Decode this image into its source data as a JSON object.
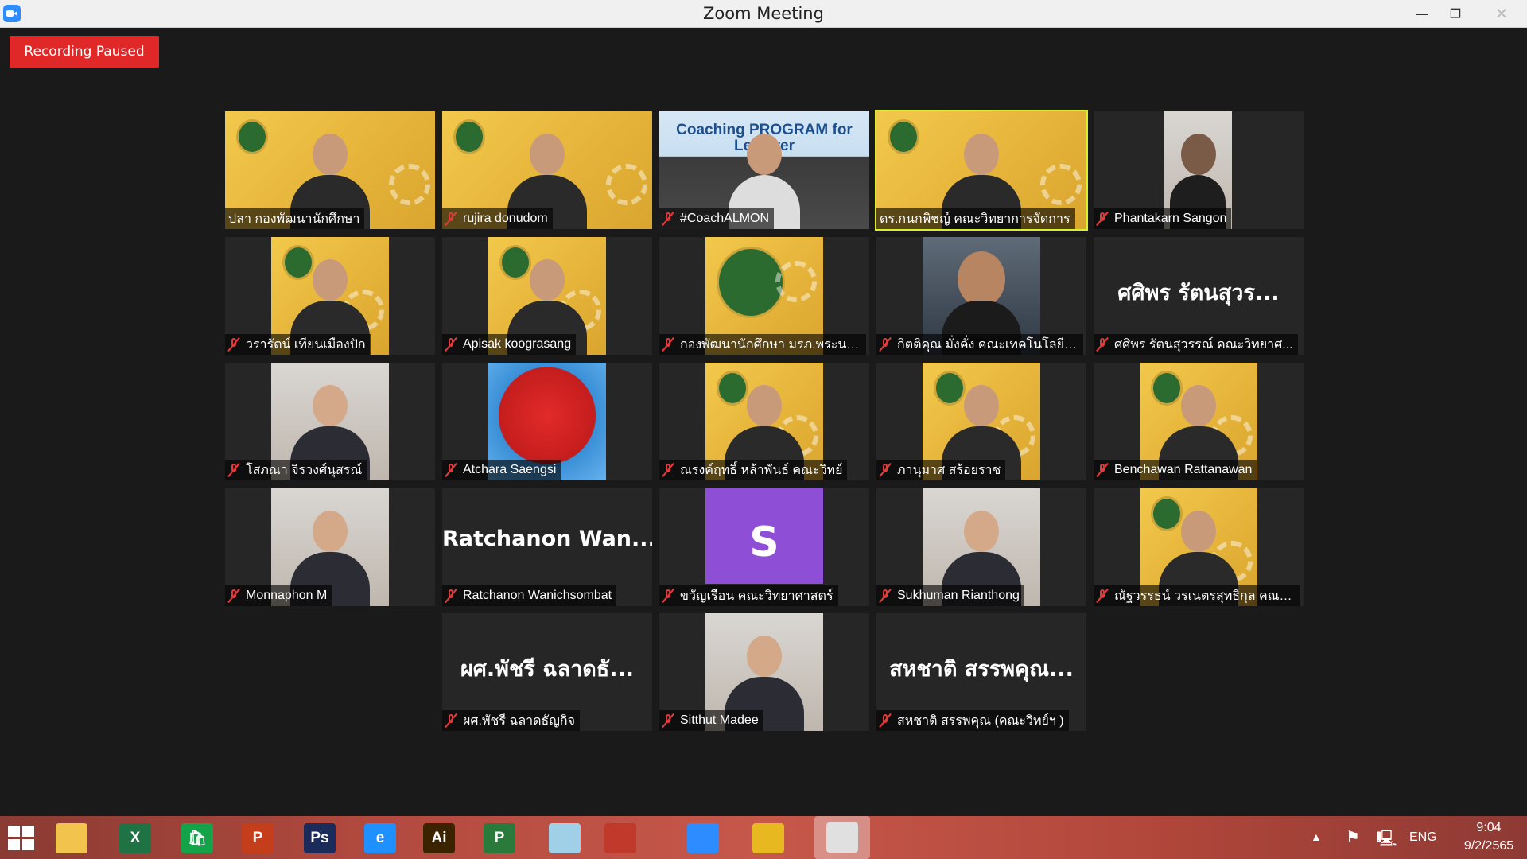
{
  "window": {
    "title": "Zoom Meeting",
    "minimize": "—",
    "maximize": "❐",
    "close": "✕"
  },
  "recording_status": "Recording Paused",
  "participants": [
    {
      "name": "ปลา กองพัฒนานักศึกษา",
      "muted": false,
      "active_speaker": false,
      "video": "person-yellow"
    },
    {
      "name": "rujira donudom",
      "muted": true,
      "active_speaker": false,
      "video": "person-yellow"
    },
    {
      "name": "#CoachALMON",
      "muted": true,
      "active_speaker": false,
      "video": "coaching",
      "banner": "Coaching PROGRAM for Lecturer"
    },
    {
      "name": "ดร.กนกพิชญ์ คณะวิทยาการจัดการ",
      "muted": false,
      "active_speaker": true,
      "video": "person-yellow"
    },
    {
      "name": "Phantakarn Sangon",
      "muted": true,
      "active_speaker": false,
      "video": "person-dark"
    },
    {
      "name": "วรารัตน์ เทียนเมืองปัก",
      "muted": true,
      "active_speaker": false,
      "video": "person-yellow"
    },
    {
      "name": "Apisak koograsang",
      "muted": true,
      "active_speaker": false,
      "video": "person-yellow"
    },
    {
      "name": "กองพัฒนานักศึกษา มรภ.พระนคร",
      "muted": true,
      "active_speaker": false,
      "video": "logo-yellow"
    },
    {
      "name": "กิตติคุณ มั่งคั่ง คณะเทคโนโลยีอุ...",
      "muted": true,
      "active_speaker": false,
      "video": "person-cartoon"
    },
    {
      "name": "ศศิพร รัตนสุวรรณ์ คณะวิทยาศ...",
      "muted": true,
      "active_speaker": false,
      "video": "name-only",
      "display_name": "ศศิพร รัตนสุวร..."
    },
    {
      "name": "โสภณา จิรวงศ์นุสรณ์",
      "muted": true,
      "active_speaker": false,
      "video": "person-light"
    },
    {
      "name": "Atchara Saengsi",
      "muted": true,
      "active_speaker": false,
      "video": "bird"
    },
    {
      "name": "ณรงค์ฤทธิ์ หล้าพันธ์ คณะวิทย์",
      "muted": true,
      "active_speaker": false,
      "video": "person-yellow"
    },
    {
      "name": "ภานุมาศ สร้อยราช",
      "muted": true,
      "active_speaker": false,
      "video": "person-yellow"
    },
    {
      "name": "Benchawan Rattanawan",
      "muted": true,
      "active_speaker": false,
      "video": "person-yellow"
    },
    {
      "name": "Monnaphon M",
      "muted": true,
      "active_speaker": false,
      "video": "person-light"
    },
    {
      "name": "Ratchanon Wanichsombat",
      "muted": true,
      "active_speaker": false,
      "video": "name-only",
      "display_name": "Ratchanon  Wan..."
    },
    {
      "name": "ขวัญเรือน คณะวิทยาศาสตร์",
      "muted": true,
      "active_speaker": false,
      "video": "initial",
      "initial": "S"
    },
    {
      "name": "Sukhuman Rianthong",
      "muted": true,
      "active_speaker": false,
      "video": "person-light"
    },
    {
      "name": "ณัฐวรรธน์ วรเนตรสุทธิกุล คณะเ...",
      "muted": true,
      "active_speaker": false,
      "video": "person-yellow"
    },
    {
      "name": "ผศ.พัชรี ฉลาดธัญกิจ",
      "muted": true,
      "active_speaker": false,
      "video": "name-only",
      "display_name": "ผศ.พัชรี ฉลาดธั..."
    },
    {
      "name": "Sitthut Madee",
      "muted": true,
      "active_speaker": false,
      "video": "person-light"
    },
    {
      "name": "สหชาติ สรรพคุณ (คณะวิทย์ฯ )",
      "muted": true,
      "active_speaker": false,
      "video": "name-only",
      "display_name": "สหชาติ สรรพคุณ..."
    }
  ],
  "taskbar": {
    "apps": [
      {
        "name": "file-explorer",
        "label": "",
        "color": "#f2c34d"
      },
      {
        "name": "excel",
        "label": "X",
        "color": "#1f7244"
      },
      {
        "name": "store",
        "label": "🛍",
        "color": "#15a34a"
      },
      {
        "name": "powerpoint",
        "label": "P",
        "color": "#c43e1c"
      },
      {
        "name": "photoshop",
        "label": "Ps",
        "color": "#1b2b5a"
      },
      {
        "name": "internet-explorer",
        "label": "e",
        "color": "#1e90ff"
      },
      {
        "name": "illustrator",
        "label": "Ai",
        "color": "#3b2300"
      },
      {
        "name": "project",
        "label": "P",
        "color": "#2a7a3b"
      },
      {
        "name": "notepad",
        "label": "",
        "color": "#9fd0e8"
      },
      {
        "name": "photoscape",
        "label": "",
        "color": "#c0392b"
      },
      {
        "name": "zoom",
        "label": "",
        "color": "#2d8cff"
      },
      {
        "name": "chrome",
        "label": "",
        "color": "#e8b820"
      },
      {
        "name": "photos",
        "label": "",
        "color": "#e0e0e0"
      }
    ],
    "tray": {
      "language": "ENG",
      "time": "9:04",
      "date": "9/2/2565"
    }
  }
}
